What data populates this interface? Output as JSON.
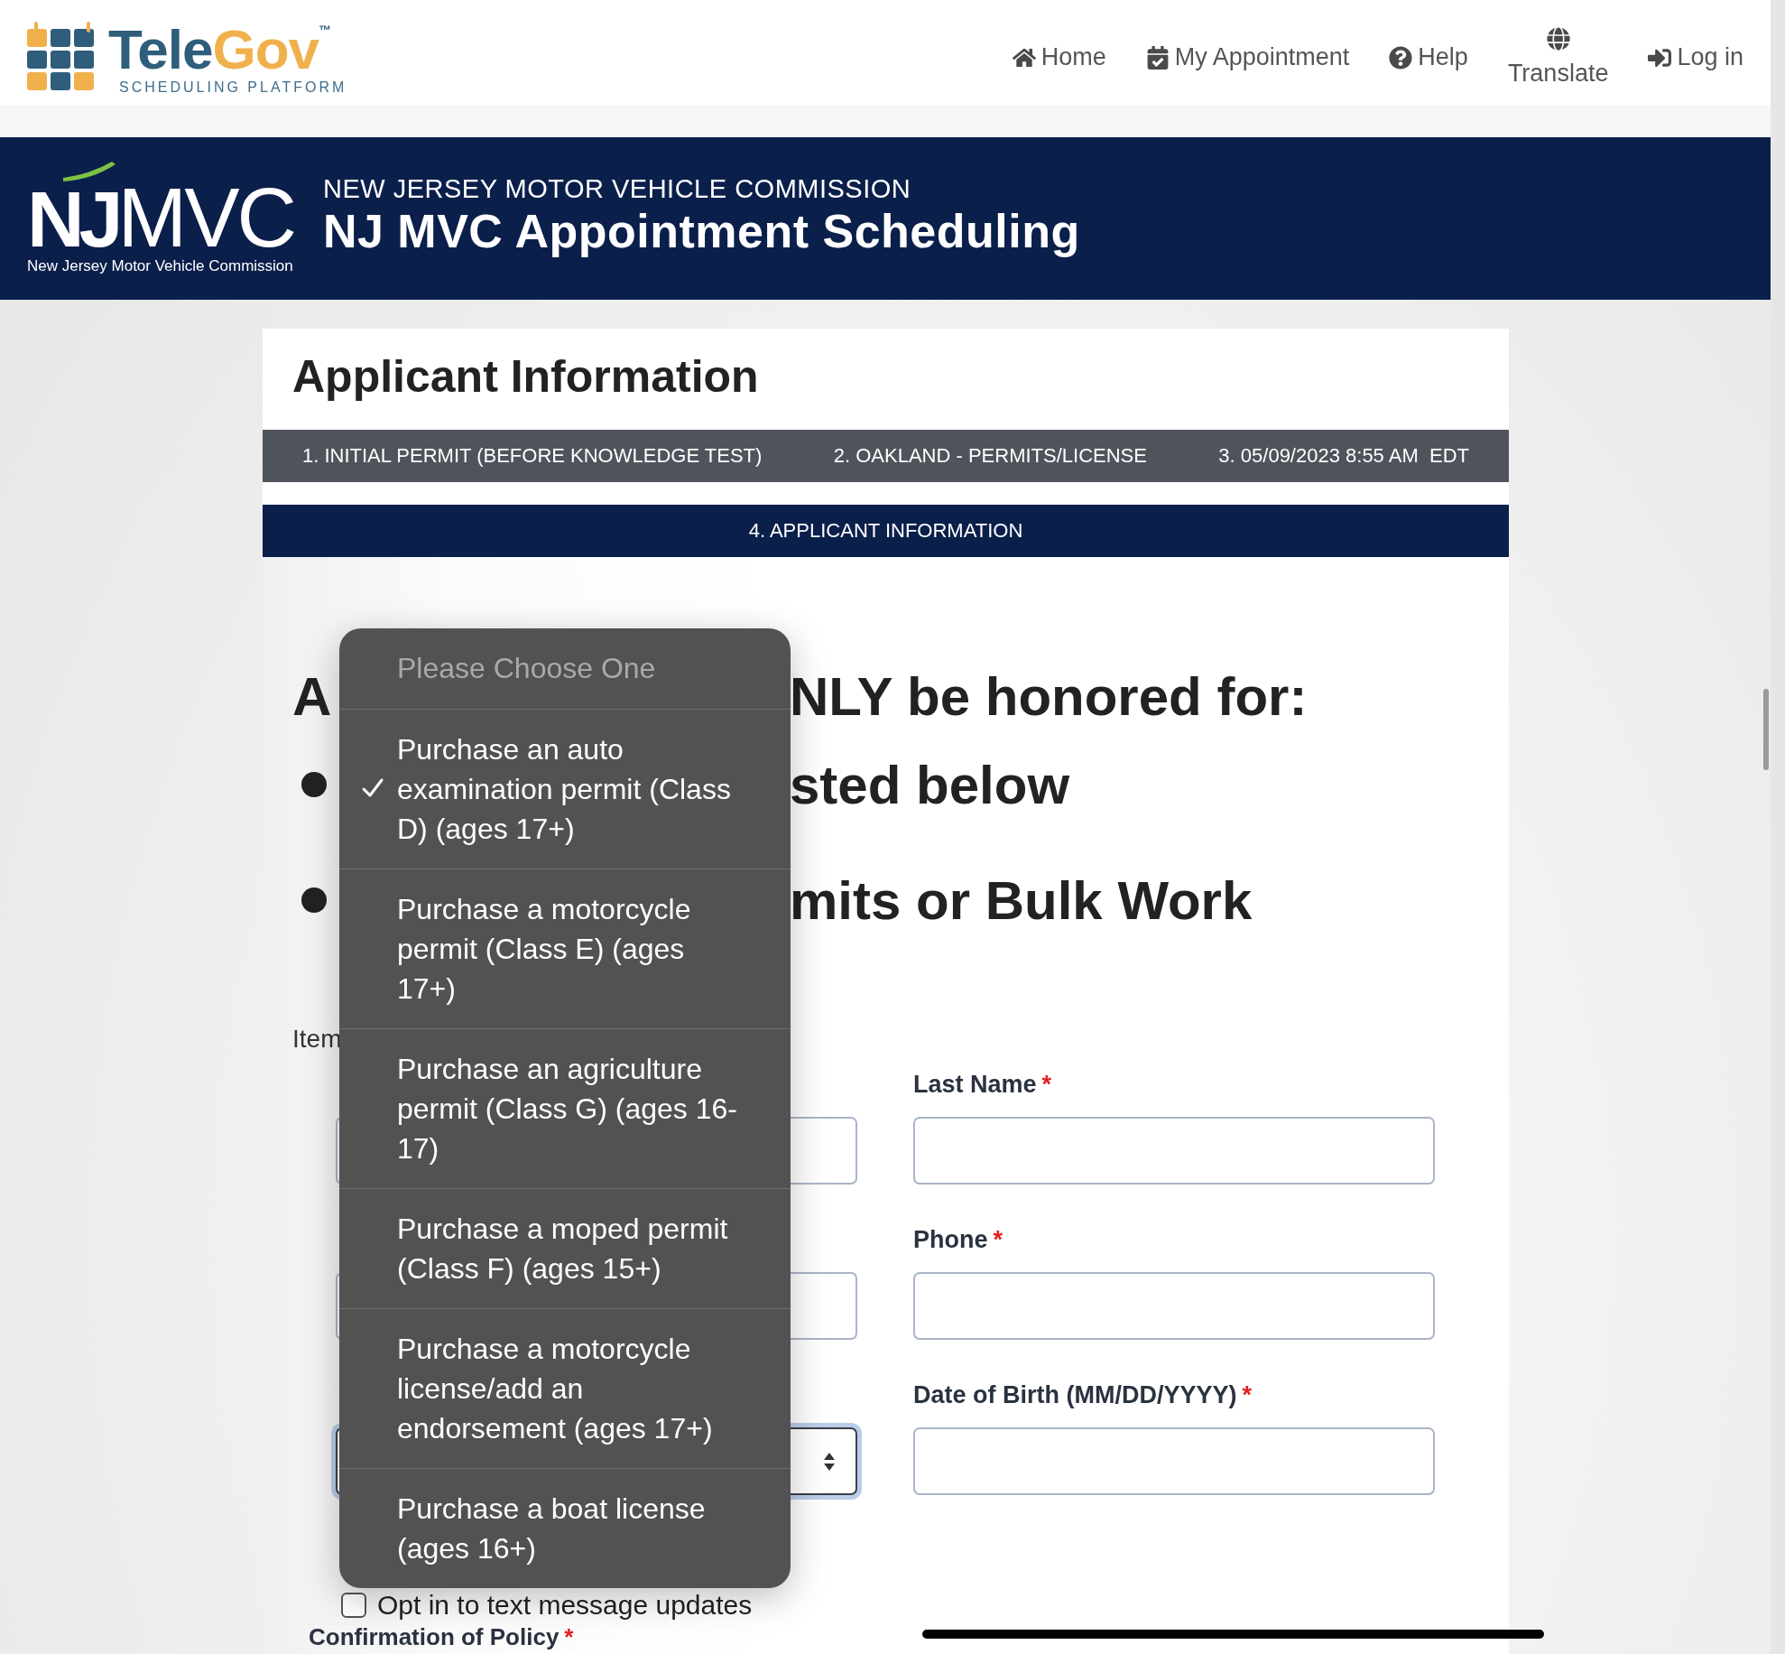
{
  "nav": {
    "logo": {
      "name_part1": "Tele",
      "name_part2": "Gov",
      "trademark": "™",
      "tagline": "SCHEDULING PLATFORM"
    },
    "items": [
      {
        "label": "Home",
        "kind": "home"
      },
      {
        "label": "My Appointment",
        "kind": "calendar"
      },
      {
        "label": "Help",
        "kind": "help"
      },
      {
        "label": "Translate",
        "kind": "globe"
      },
      {
        "label": "Log in",
        "kind": "login"
      }
    ]
  },
  "banner": {
    "logo": {
      "mark_bold": "NJ",
      "mark_light": "MVC",
      "caption": "New Jersey Motor Vehicle Commission"
    },
    "overline": "NEW JERSEY MOTOR VEHICLE COMMISSION",
    "title": "NJ MVC Appointment Scheduling"
  },
  "card": {
    "title": "Applicant Information",
    "steps": [
      {
        "label": "1. INITIAL PERMIT (BEFORE KNOWLEDGE TEST)",
        "selected": false
      },
      {
        "label": "2. OAKLAND - PERMITS/LICENSE",
        "selected": false
      },
      {
        "label": "3. 05/09/2023 8:55 AM  EDT",
        "selected": false
      },
      {
        "label": "4. APPLICANT INFORMATION",
        "selected": true
      }
    ],
    "notice": [
      {
        "kind": "heading",
        "left": "A",
        "right": "NLY be honored for:"
      },
      {
        "kind": "bullet",
        "right": "sted below"
      },
      {
        "kind": "bullet",
        "right": "mits or Bulk Work"
      }
    ],
    "form": {
      "section_label": "Item",
      "left_fields": [
        {
          "kind": "input"
        },
        {
          "kind": "input"
        },
        {
          "kind": "select",
          "focused": true
        }
      ],
      "right_fields": [
        {
          "label": "Last Name",
          "required_mark": "*"
        },
        {
          "label": "Phone",
          "required_mark": "*"
        },
        {
          "label": "Date of Birth (MM/DD/YYYY)",
          "required_mark": "*"
        }
      ],
      "opt_in": {
        "label": "Opt in to text message updates",
        "checked": false
      },
      "policy": {
        "label": "Confirmation of Policy",
        "required_mark": "*"
      }
    }
  },
  "dropdown": {
    "prompt": "Please Choose One",
    "options": [
      {
        "label": "Purchase an auto examination permit (Class D) (ages 17+)",
        "selected": true
      },
      {
        "label": "Purchase a motorcycle permit (Class E) (ages 17+)",
        "selected": false
      },
      {
        "label": "Purchase an agriculture permit (Class G) (ages 16-17)",
        "selected": false
      },
      {
        "label": "Purchase a moped permit (Class F) (ages 15+)",
        "selected": false
      },
      {
        "label": "Purchase a motorcycle license/add an endorsement (ages 17+)",
        "selected": false
      },
      {
        "label": "Purchase a boat license (ages 16+)",
        "selected": false
      }
    ]
  }
}
